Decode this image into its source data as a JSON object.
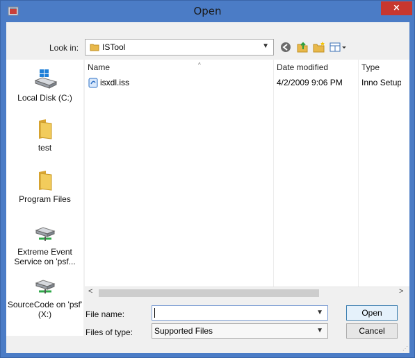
{
  "window": {
    "title": "Open",
    "close_glyph": "×",
    "colors": {
      "frame": "#4b7cc6",
      "close": "#c7372f",
      "client": "#f0f0f0"
    }
  },
  "toolbar": {
    "look_in_label": "Look in:",
    "look_in_value": "ISTool",
    "buttons": [
      "back-icon",
      "up-folder-icon",
      "new-folder-icon",
      "view-menu-icon"
    ]
  },
  "places": [
    {
      "label": "Local Disk (C:)",
      "icon": "local-disk-icon"
    },
    {
      "label": "test",
      "icon": "folder-icon"
    },
    {
      "label": "Program Files",
      "icon": "folder-icon"
    },
    {
      "label": "Extreme Event Service on 'psf...",
      "icon": "network-drive-icon"
    },
    {
      "label": "SourceCode on 'psf' (X:)",
      "icon": "network-drive-icon"
    }
  ],
  "list": {
    "columns": [
      "Name",
      "Date modified",
      "Type"
    ],
    "sort_glyph": "^",
    "rows": [
      {
        "name": "isxdl.iss",
        "date": "4/2/2009 9:06 PM",
        "type": "Inno Setup"
      }
    ],
    "scroll_left": "<",
    "scroll_right": ">"
  },
  "bottom": {
    "file_name_label": "File name:",
    "file_name_value": "",
    "files_of_type_label": "Files of type:",
    "files_of_type_value": "Supported Files",
    "open_button": "Open",
    "cancel_button": "Cancel"
  }
}
